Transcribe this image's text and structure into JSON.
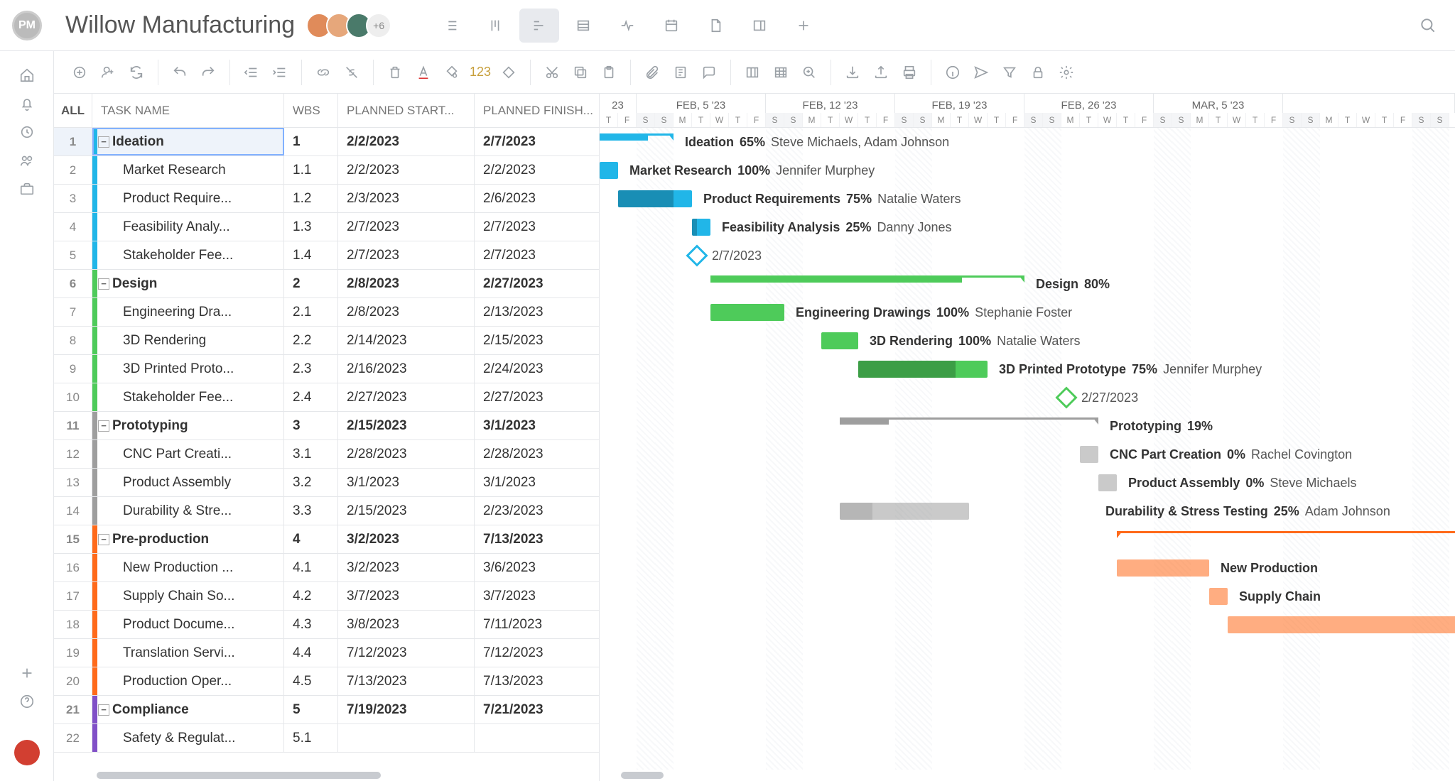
{
  "app": {
    "logo_text": "PM",
    "project_title": "Willow Manufacturing",
    "avatar_overflow": "+6"
  },
  "sidenav": {
    "icons": [
      "home-icon",
      "bell-icon",
      "clock-icon",
      "users-icon",
      "briefcase-icon"
    ],
    "bottom_icons": [
      "plus-icon",
      "help-icon"
    ]
  },
  "top_views": [
    {
      "name": "list-view-icon",
      "active": false
    },
    {
      "name": "board-view-icon",
      "active": false
    },
    {
      "name": "gantt-view-icon",
      "active": true
    },
    {
      "name": "table-view-icon",
      "active": false
    },
    {
      "name": "status-view-icon",
      "active": false
    },
    {
      "name": "calendar-view-icon",
      "active": false
    },
    {
      "name": "file-view-icon",
      "active": false
    },
    {
      "name": "panel-view-icon",
      "active": false
    },
    {
      "name": "add-view-icon",
      "active": false
    }
  ],
  "toolbar": {
    "groups": [
      [
        "add-task-icon",
        "add-user-icon",
        "refresh-icon"
      ],
      [
        "undo-icon",
        "redo-icon"
      ],
      [
        "outdent-icon",
        "indent-icon"
      ],
      [
        "link-tasks-icon",
        "unlink-tasks-icon"
      ],
      [
        "delete-icon",
        "text-color-icon",
        "fill-color-icon"
      ],
      [
        "cut-icon",
        "copy-icon",
        "paste-icon"
      ],
      [
        "attach-icon",
        "note-icon",
        "comment-icon"
      ],
      [
        "columns-icon",
        "grid-icon",
        "zoom-icon"
      ],
      [
        "import-icon",
        "export-icon",
        "print-icon"
      ],
      [
        "info-icon",
        "send-icon",
        "filter-icon",
        "lock-icon",
        "settings-icon"
      ]
    ],
    "number_badge": "123"
  },
  "columns": {
    "all": "ALL",
    "name": "TASK NAME",
    "wbs": "WBS",
    "start": "PLANNED START...",
    "finish": "PLANNED FINISH..."
  },
  "colors": {
    "ideation": "#21b6e8",
    "design": "#4ecb5a",
    "prototyping": "#9e9e9e",
    "preprod": "#ff6a1a",
    "compliance": "#8150c7"
  },
  "tasks": [
    {
      "idx": 1,
      "phase": true,
      "color": "ideation",
      "indent": 0,
      "name": "Ideation",
      "wbs": "1",
      "start": "2/2/2023",
      "finish": "2/7/2023",
      "selected": true
    },
    {
      "idx": 2,
      "phase": false,
      "color": "ideation",
      "indent": 2,
      "name": "Market Research",
      "wbs": "1.1",
      "start": "2/2/2023",
      "finish": "2/2/2023"
    },
    {
      "idx": 3,
      "phase": false,
      "color": "ideation",
      "indent": 2,
      "name": "Product Require...",
      "wbs": "1.2",
      "start": "2/3/2023",
      "finish": "2/6/2023"
    },
    {
      "idx": 4,
      "phase": false,
      "color": "ideation",
      "indent": 2,
      "name": "Feasibility Analy...",
      "wbs": "1.3",
      "start": "2/7/2023",
      "finish": "2/7/2023"
    },
    {
      "idx": 5,
      "phase": false,
      "color": "ideation",
      "indent": 2,
      "name": "Stakeholder Fee...",
      "wbs": "1.4",
      "start": "2/7/2023",
      "finish": "2/7/2023"
    },
    {
      "idx": 6,
      "phase": true,
      "color": "design",
      "indent": 0,
      "name": "Design",
      "wbs": "2",
      "start": "2/8/2023",
      "finish": "2/27/2023"
    },
    {
      "idx": 7,
      "phase": false,
      "color": "design",
      "indent": 2,
      "name": "Engineering Dra...",
      "wbs": "2.1",
      "start": "2/8/2023",
      "finish": "2/13/2023"
    },
    {
      "idx": 8,
      "phase": false,
      "color": "design",
      "indent": 2,
      "name": "3D Rendering",
      "wbs": "2.2",
      "start": "2/14/2023",
      "finish": "2/15/2023"
    },
    {
      "idx": 9,
      "phase": false,
      "color": "design",
      "indent": 2,
      "name": "3D Printed Proto...",
      "wbs": "2.3",
      "start": "2/16/2023",
      "finish": "2/24/2023"
    },
    {
      "idx": 10,
      "phase": false,
      "color": "design",
      "indent": 2,
      "name": "Stakeholder Fee...",
      "wbs": "2.4",
      "start": "2/27/2023",
      "finish": "2/27/2023"
    },
    {
      "idx": 11,
      "phase": true,
      "color": "prototyping",
      "indent": 0,
      "name": "Prototyping",
      "wbs": "3",
      "start": "2/15/2023",
      "finish": "3/1/2023"
    },
    {
      "idx": 12,
      "phase": false,
      "color": "prototyping",
      "indent": 2,
      "name": "CNC Part Creati...",
      "wbs": "3.1",
      "start": "2/28/2023",
      "finish": "2/28/2023"
    },
    {
      "idx": 13,
      "phase": false,
      "color": "prototyping",
      "indent": 2,
      "name": "Product Assembly",
      "wbs": "3.2",
      "start": "3/1/2023",
      "finish": "3/1/2023"
    },
    {
      "idx": 14,
      "phase": false,
      "color": "prototyping",
      "indent": 2,
      "name": "Durability & Stre...",
      "wbs": "3.3",
      "start": "2/15/2023",
      "finish": "2/23/2023"
    },
    {
      "idx": 15,
      "phase": true,
      "color": "preprod",
      "indent": 0,
      "name": "Pre-production",
      "wbs": "4",
      "start": "3/2/2023",
      "finish": "7/13/2023"
    },
    {
      "idx": 16,
      "phase": false,
      "color": "preprod",
      "indent": 2,
      "name": "New Production ...",
      "wbs": "4.1",
      "start": "3/2/2023",
      "finish": "3/6/2023"
    },
    {
      "idx": 17,
      "phase": false,
      "color": "preprod",
      "indent": 2,
      "name": "Supply Chain So...",
      "wbs": "4.2",
      "start": "3/7/2023",
      "finish": "3/7/2023"
    },
    {
      "idx": 18,
      "phase": false,
      "color": "preprod",
      "indent": 2,
      "name": "Product Docume...",
      "wbs": "4.3",
      "start": "3/8/2023",
      "finish": "7/11/2023"
    },
    {
      "idx": 19,
      "phase": false,
      "color": "preprod",
      "indent": 2,
      "name": "Translation Servi...",
      "wbs": "4.4",
      "start": "7/12/2023",
      "finish": "7/12/2023"
    },
    {
      "idx": 20,
      "phase": false,
      "color": "preprod",
      "indent": 2,
      "name": "Production Oper...",
      "wbs": "4.5",
      "start": "7/13/2023",
      "finish": "7/13/2023"
    },
    {
      "idx": 21,
      "phase": true,
      "color": "compliance",
      "indent": 0,
      "name": "Compliance",
      "wbs": "5",
      "start": "7/19/2023",
      "finish": "7/21/2023"
    },
    {
      "idx": 22,
      "phase": false,
      "color": "compliance",
      "indent": 2,
      "name": "Safety & Regulat...",
      "wbs": "5.1",
      "start": "",
      "finish": ""
    }
  ],
  "timeline": {
    "day_width": 26,
    "start_prefix": "23",
    "start_date": "2023-02-02",
    "days_visible": 47,
    "weeks": [
      "FEB, 5 '23",
      "FEB, 12 '23",
      "FEB, 19 '23",
      "FEB, 26 '23",
      "MAR, 5 '23"
    ],
    "day_letters": [
      "S",
      "M",
      "T",
      "W",
      "T",
      "F",
      "S"
    ]
  },
  "gantt_rows": [
    {
      "row": 1,
      "type": "summary",
      "color": "ideation",
      "start": 0,
      "dur": 4,
      "pct": 65,
      "label": "Ideation",
      "pct_txt": "65%",
      "assignees": "Steve Michaels, Adam Johnson"
    },
    {
      "row": 2,
      "type": "task",
      "color": "ideation",
      "start": 0,
      "dur": 1,
      "pct": 100,
      "label": "Market Research",
      "pct_txt": "100%",
      "assignees": "Jennifer Murphey"
    },
    {
      "row": 3,
      "type": "task",
      "color": "ideation",
      "start": 1,
      "dur": 4,
      "pct": 75,
      "label": "Product Requirements",
      "pct_txt": "75%",
      "assignees": "Natalie Waters"
    },
    {
      "row": 4,
      "type": "task",
      "color": "ideation",
      "start": 5,
      "dur": 1,
      "pct": 25,
      "label": "Feasibility Analysis",
      "pct_txt": "25%",
      "assignees": "Danny Jones"
    },
    {
      "row": 5,
      "type": "milestone",
      "color": "ideation",
      "start": 5,
      "date_txt": "2/7/2023"
    },
    {
      "row": 6,
      "type": "summary",
      "color": "design",
      "start": 6,
      "dur": 17,
      "pct": 80,
      "label": "Design",
      "pct_txt": "80%",
      "label_side": "right"
    },
    {
      "row": 7,
      "type": "task",
      "color": "design",
      "start": 6,
      "dur": 4,
      "pct": 100,
      "label": "Engineering Drawings",
      "pct_txt": "100%",
      "assignees": "Stephanie Foster"
    },
    {
      "row": 8,
      "type": "task",
      "color": "design",
      "start": 12,
      "dur": 2,
      "pct": 100,
      "label": "3D Rendering",
      "pct_txt": "100%",
      "assignees": "Natalie Waters"
    },
    {
      "row": 9,
      "type": "task",
      "color": "design",
      "start": 14,
      "dur": 7,
      "pct": 75,
      "label": "3D Printed Prototype",
      "pct_txt": "75%",
      "assignees": "Jennifer Murphey"
    },
    {
      "row": 10,
      "type": "milestone",
      "color": "design",
      "start": 25,
      "date_txt": "2/27/2023"
    },
    {
      "row": 11,
      "type": "summary",
      "color": "prototyping",
      "start": 13,
      "dur": 14,
      "pct": 19,
      "label": "Prototyping",
      "pct_txt": "19%",
      "label_side": "right"
    },
    {
      "row": 12,
      "type": "task",
      "color": "prototyping",
      "start": 26,
      "dur": 1,
      "pct": 0,
      "label": "CNC Part Creation",
      "pct_txt": "0%",
      "assignees": "Rachel Covington",
      "light": true
    },
    {
      "row": 13,
      "type": "task",
      "color": "prototyping",
      "start": 27,
      "dur": 1,
      "pct": 0,
      "label": "Product Assembly",
      "pct_txt": "0%",
      "assignees": "Steve Michaels",
      "light": true
    },
    {
      "row": 14,
      "type": "task",
      "color": "prototyping",
      "start": 13,
      "dur": 7,
      "pct": 25,
      "label": "Durability & Stress Testing",
      "pct_txt": "25%",
      "assignees": "Adam Johnson",
      "light": true,
      "label_side": "right-far"
    },
    {
      "row": 15,
      "type": "summary",
      "color": "preprod",
      "start": 28,
      "dur": 19,
      "pct": 0,
      "label": "",
      "pct_txt": "",
      "label_side": "none"
    },
    {
      "row": 16,
      "type": "task",
      "color": "preprod",
      "start": 28,
      "dur": 5,
      "pct": 0,
      "label": "New Production",
      "pct_txt": "",
      "light": true,
      "label_side": "right"
    },
    {
      "row": 17,
      "type": "task",
      "color": "preprod",
      "start": 33,
      "dur": 1,
      "pct": 0,
      "label": "Supply Chain",
      "pct_txt": "",
      "light": true,
      "label_side": "right"
    },
    {
      "row": 18,
      "type": "task",
      "color": "preprod",
      "start": 34,
      "dur": 13,
      "pct": 0,
      "label": "",
      "light": true,
      "label_side": "none"
    }
  ]
}
